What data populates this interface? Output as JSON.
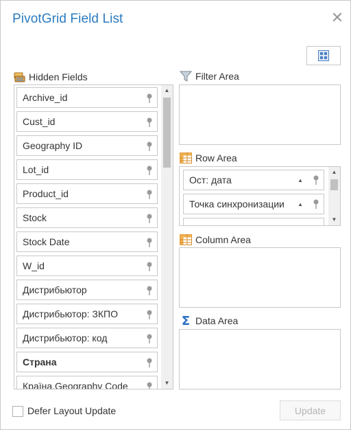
{
  "window": {
    "title": "PivotGrid Field List"
  },
  "toolbar": {
    "layout_icon": "layout-grid-icon",
    "close_icon": "close-icon"
  },
  "hidden_fields": {
    "label": "Hidden Fields",
    "icon": "hidden-fields-icon",
    "items": [
      {
        "label": "Archive_id"
      },
      {
        "label": "Cust_id"
      },
      {
        "label": "Geography ID"
      },
      {
        "label": "Lot_id"
      },
      {
        "label": "Product_id"
      },
      {
        "label": "Stock"
      },
      {
        "label": "Stock Date"
      },
      {
        "label": "W_id"
      },
      {
        "label": "Дистрибьютор"
      },
      {
        "label": "Дистрибьютор: ЗКПО"
      },
      {
        "label": "Дистрибьютор: код"
      },
      {
        "label": "Страна"
      },
      {
        "label": "Країна.Geography Code"
      }
    ]
  },
  "filter_area": {
    "label": "Filter Area",
    "icon": "filter-icon"
  },
  "row_area": {
    "label": "Row Area",
    "icon": "table-icon",
    "items": [
      {
        "label": "Ост: дата"
      },
      {
        "label": "Точка синхронизации"
      }
    ]
  },
  "column_area": {
    "label": "Column Area",
    "icon": "table-icon"
  },
  "data_area": {
    "label": "Data Area",
    "icon": "sigma-icon"
  },
  "footer": {
    "defer_label": "Defer Layout Update",
    "update_label": "Update"
  },
  "colors": {
    "title": "#2b7bbf",
    "border": "#c8c8c8",
    "disabled_text": "#b5b5b5"
  }
}
